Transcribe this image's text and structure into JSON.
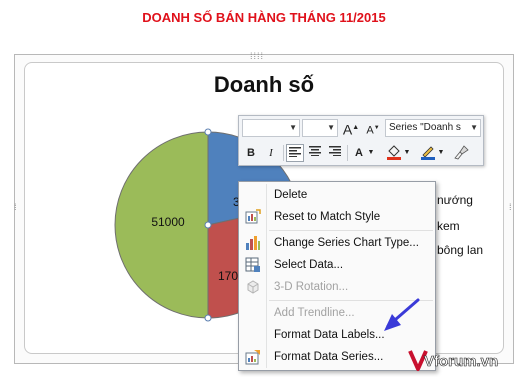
{
  "page": {
    "heading": "DOANH SỐ BÁN HÀNG THÁNG 11/2015"
  },
  "chart_data": {
    "type": "pie",
    "title": "Doanh số",
    "slices": [
      {
        "label": "51000",
        "value": 51000,
        "color": "#9bbb59"
      },
      {
        "label": "3",
        "value": null,
        "color": "#4f81bd"
      },
      {
        "label": "170",
        "value": null,
        "color": "#c0504d"
      }
    ],
    "legend": {
      "placement": "right",
      "items": [
        "nướng",
        "kem",
        "bông lan"
      ]
    }
  },
  "mini_toolbar": {
    "font_name": "",
    "font_size": "",
    "element_selector": "Series \"Doanh s",
    "bold": "B",
    "italic": "I",
    "font_color_label": "A"
  },
  "context_menu": {
    "items": [
      {
        "label": "Delete",
        "enabled": true,
        "icon": ""
      },
      {
        "label": "Reset to Match Style",
        "enabled": true,
        "icon": "reset-style-icon"
      },
      {
        "label": "Change Series Chart Type...",
        "enabled": true,
        "icon": "chart-type-icon"
      },
      {
        "label": "Select Data...",
        "enabled": true,
        "icon": "select-data-icon"
      },
      {
        "label": "3-D Rotation...",
        "enabled": false,
        "icon": "rotation-icon"
      },
      {
        "label": "Add Trendline...",
        "enabled": false,
        "icon": ""
      },
      {
        "label": "Format Data Labels...",
        "enabled": true,
        "icon": ""
      },
      {
        "label": "Format Data Series...",
        "enabled": true,
        "icon": "format-series-icon"
      }
    ]
  },
  "watermark": {
    "text": "Vforum.vn",
    "brand_color": "#c8102e"
  },
  "colors": {
    "heading": "#e0111b",
    "annotation_arrow": "#3a3ad8"
  }
}
